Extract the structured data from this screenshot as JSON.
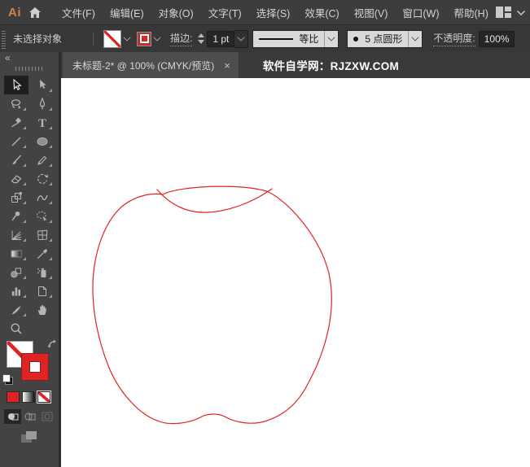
{
  "colors": {
    "artwork_stroke": "#e02424",
    "logo_orange": "#d4824f",
    "ui_dark": "#3d3d3d"
  },
  "menubar": {
    "logo": "Ai",
    "items": [
      "文件(F)",
      "编辑(E)",
      "对象(O)",
      "文字(T)",
      "选择(S)",
      "效果(C)",
      "视图(V)",
      "窗口(W)",
      "帮助(H)"
    ]
  },
  "control_bar": {
    "status": "未选择对象",
    "stroke_label": "描边:",
    "stroke_width": "1 pt",
    "variable_width_profile": "等比",
    "brush_definition": "5 点圆形",
    "opacity_label": "不透明度:",
    "opacity_value": "100%"
  },
  "tab_bar": {
    "tab_title": "未标题-2* @ 100% (CMYK/预览)",
    "close": "×",
    "site_text": "软件自学网：RJZXW.COM"
  },
  "toolbar": {
    "collapse": "«",
    "tools": [
      "selection",
      "direct-selection",
      "magic-wand",
      "pen",
      "curvature",
      "type",
      "line-segment",
      "ellipse",
      "paintbrush",
      "pencil",
      "eraser",
      "rotate",
      "scale",
      "width",
      "puppet-warp",
      "shape-builder",
      "perspective-grid",
      "mesh",
      "gradient",
      "eyedropper",
      "blend",
      "symbol-sprayer",
      "column-graph",
      "artboard",
      "knife",
      "hand",
      "zoom"
    ],
    "active_tool": "selection",
    "fill": "none",
    "stroke": "#e02424"
  },
  "canvas": {
    "artwork": "apple outline (open red stroked path with top dimple curve)",
    "stroke_color": "#e02424"
  }
}
